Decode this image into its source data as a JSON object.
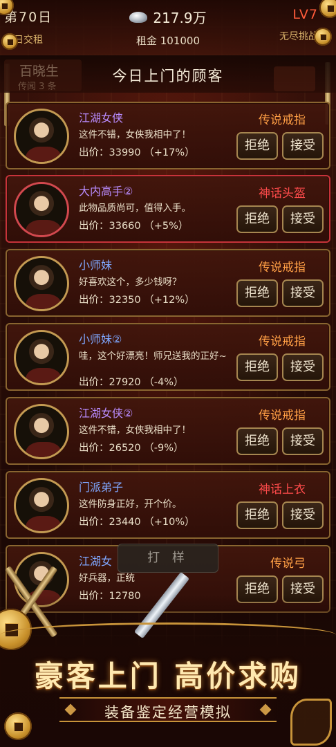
{
  "topbar": {
    "day": "第70日",
    "left_sub": "今日交租",
    "money": "217.9万",
    "rent": "租金 101000",
    "level": "LV7",
    "right_sub": "无尽挑战"
  },
  "header": {
    "ghost_name": "百晓生",
    "ghost_sub": "传闻 3 条",
    "title": "今日上门的顾客"
  },
  "buttons": {
    "reject": "拒绝",
    "accept": "接受",
    "smith": "打 样"
  },
  "customers": [
    {
      "name": "江湖女侠",
      "line": "这件不错，女侠我相中了！",
      "offer": "出价：33990  （+17%）",
      "item": "传说戒指"
    },
    {
      "name": "大内高手②",
      "line": "此物品质尚可，值得入手。",
      "offer": "出价：33660  （+5%）",
      "item": "神话头盔"
    },
    {
      "name": "小师妹",
      "line": "好喜欢这个，多少钱呀？",
      "offer": "出价：32350  （+12%）",
      "item": "传说戒指"
    },
    {
      "name": "小师妹②",
      "line": "哇，这个好漂亮！师兄送我的正好~",
      "offer": "出价：27920  （-4%）",
      "item": "传说戒指"
    },
    {
      "name": "江湖女侠②",
      "line": "这件不错，女侠我相中了！",
      "offer": "出价：26520  （-9%）",
      "item": "传说戒指"
    },
    {
      "name": "门派弟子",
      "line": "这件防身正好，开个价。",
      "offer": "出价：23440  （+10%）",
      "item": "神话上衣"
    },
    {
      "name": "江湖女",
      "line": "好兵器，正统",
      "offer": "出价：12780",
      "item": "传说弓"
    }
  ],
  "banner": {
    "title": "豪客上门 高价求购",
    "subtitle": "装备鉴定经营模拟"
  },
  "colors": {
    "purple_name": "#b98cff",
    "blue_name": "#7fa7ff",
    "legend_item": "#ff9f45",
    "mythic_item": "#ff4b4b",
    "level": "#ff5b3a"
  }
}
